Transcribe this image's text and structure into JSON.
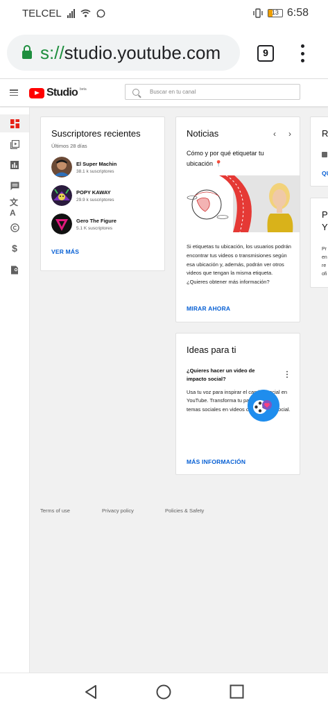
{
  "status_bar": {
    "carrier": "TELCEL",
    "battery": "13",
    "time": "6:58"
  },
  "browser": {
    "url_scheme": "s://",
    "url_host": "studio.youtube.com",
    "tab_count": "9"
  },
  "studio": {
    "logo_text": "Studio",
    "logo_badge": "beta",
    "search_placeholder": "Buscar en tu canal",
    "brand_color": "#ff0000",
    "link_color": "#065fd4"
  },
  "sidebar": {
    "items": [
      {
        "icon": "dashboard-icon",
        "active": true
      },
      {
        "icon": "videos-icon",
        "active": false
      },
      {
        "icon": "analytics-icon",
        "active": false
      },
      {
        "icon": "comments-icon",
        "active": false
      },
      {
        "icon": "subtitles-icon",
        "active": false
      },
      {
        "icon": "copyright-icon",
        "active": false
      },
      {
        "icon": "monetization-icon",
        "active": false
      },
      {
        "icon": "audio-library-icon",
        "active": false
      }
    ]
  },
  "subscribers_card": {
    "title": "Suscriptores recientes",
    "subtitle": "Últimos 28 días",
    "items": [
      {
        "name": "El Super Machin",
        "count": "38.1 k suscriptores"
      },
      {
        "name": "POPY KAWAY",
        "count": "29.9 k suscriptores"
      },
      {
        "name": "Gero The Figure",
        "count": "5.1 K suscriptores"
      }
    ],
    "see_more": "VER MÁS"
  },
  "news_card": {
    "title": "Noticias",
    "headline": "Cómo y por qué etiquetar tu ubicación 📍",
    "body": "Si etiquetas tu ubicación, los usuarios podrán encontrar tus videos o transmisiones según esa ubicación y, además, podrán ver otros videos que tengan la misma etiqueta. ¿Quieres obtener más información?",
    "cta": "MIRAR AHORA"
  },
  "ideas_card": {
    "title": "Ideas para ti",
    "question": "¿Quieres hacer un video de impacto social?",
    "body": "Usa tu voz para inspirar el cambio social en YouTube. Transforma tu pasión por los temas sociales en videos con impacto social.",
    "cta": "MÁS INFORMACIÓN"
  },
  "partial_cards": {
    "card1_title": "Re",
    "card1_link": "QU",
    "card2_title_1": "Pr",
    "card2_title_2": "Y",
    "card2_lines": [
      "Pr",
      "en",
      "re",
      "ofi"
    ]
  },
  "footer": {
    "terms": "Terms of use",
    "privacy": "Privacy policy",
    "policies": "Policies & Safety"
  }
}
